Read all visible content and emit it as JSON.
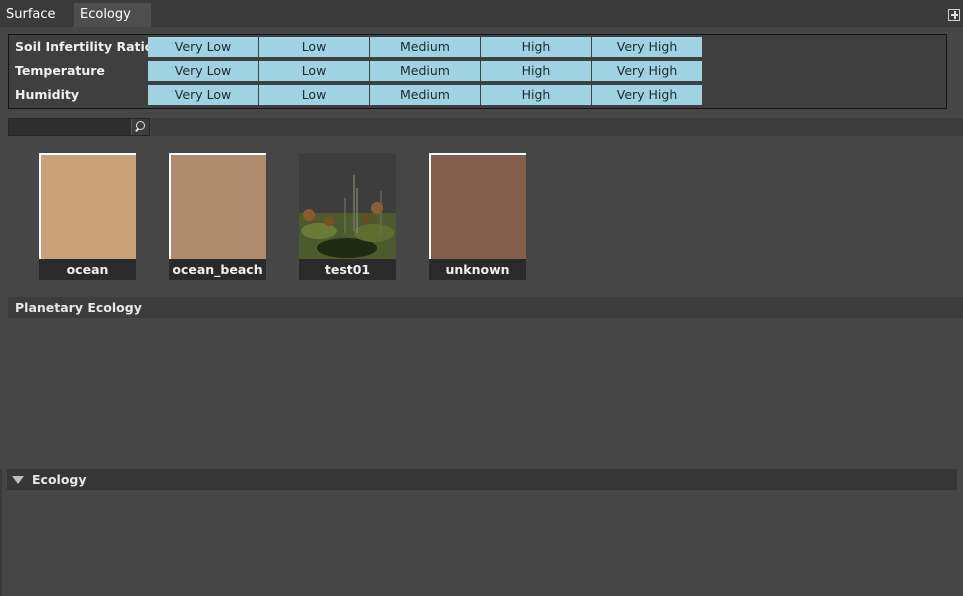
{
  "tabs": [
    {
      "label": "Surface",
      "active": false
    },
    {
      "label": "Ecology",
      "active": true
    }
  ],
  "params": [
    {
      "label": "Soil Infertility Ratio",
      "options": [
        "Very Low",
        "Low",
        "Medium",
        "High",
        "Very High"
      ]
    },
    {
      "label": "Temperature",
      "options": [
        "Very Low",
        "Low",
        "Medium",
        "High",
        "Very High"
      ]
    },
    {
      "label": "Humidity",
      "options": [
        "Very Low",
        "Low",
        "Medium",
        "High",
        "Very High"
      ]
    }
  ],
  "search": {
    "value": "",
    "icon": "search-icon"
  },
  "gallery": [
    {
      "name": "ocean",
      "color": "#c9a27a"
    },
    {
      "name": "ocean_beach",
      "color": "#ae8b6d"
    },
    {
      "name": "test01",
      "color": "scene"
    },
    {
      "name": "unknown",
      "color": "#835f4c"
    }
  ],
  "planetary_section": {
    "label": "Planetary Ecology"
  },
  "ecology_section": {
    "label": "Ecology",
    "expanded": true
  },
  "colors": {
    "button_bg": "#9fd3e3",
    "panel_bg": "#464646"
  }
}
